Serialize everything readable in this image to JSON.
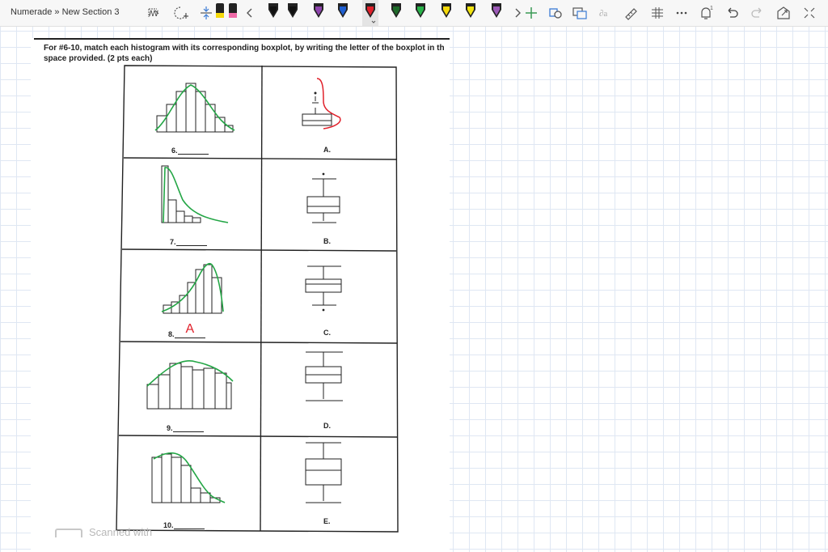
{
  "app": {
    "breadcrumb": "Numerade » New Section 3"
  },
  "toolbar": {
    "icons": [
      "lasso-select-icon",
      "add-space-icon",
      "insert-space-icon",
      "scroll-left-icon",
      "scroll-right-icon",
      "add-pen-icon",
      "ink-to-shape-icon",
      "ink-to-text-icon",
      "math-icon",
      "ruler-icon",
      "format-icon",
      "more-icon",
      "notification-icon",
      "undo-icon",
      "redo-icon",
      "fullscreen-icon",
      "collapse-icon"
    ],
    "pens": [
      {
        "name": "yellow-highlighter",
        "color": "#f5d90a"
      },
      {
        "name": "pink-highlighter",
        "color": "#f06aa8"
      },
      {
        "name": "black-pen",
        "color": "#111111"
      },
      {
        "name": "black-pen-2",
        "color": "#111111"
      },
      {
        "name": "purple-pen",
        "color": "#8e44ad"
      },
      {
        "name": "blue-pen",
        "color": "#1f5fd1"
      },
      {
        "name": "red-pen",
        "color": "#e0202a",
        "selected": true
      },
      {
        "name": "dark-green-pen",
        "color": "#1e6b2a"
      },
      {
        "name": "green-pen",
        "color": "#29b34a"
      },
      {
        "name": "yellow-pen",
        "color": "#f5d90a"
      },
      {
        "name": "yellow-pen-2",
        "color": "#f2e40f"
      },
      {
        "name": "purple-pen-2",
        "color": "#9b59b6"
      }
    ],
    "notification_count": "1"
  },
  "worksheet": {
    "instructions": [
      "For #6-10, match each histogram with its corresponding boxplot, by writing the letter of the boxplot in th",
      "space provided. (2 pts each)"
    ],
    "rows": [
      {
        "question": "6.",
        "answer": "",
        "boxplot_letter": "A."
      },
      {
        "question": "7.",
        "answer": "",
        "boxplot_letter": "B."
      },
      {
        "question": "8.",
        "answer": "A",
        "boxplot_letter": "C."
      },
      {
        "question": "9.",
        "answer": "",
        "boxplot_letter": "D."
      },
      {
        "question": "10.",
        "answer": "",
        "boxplot_letter": "E."
      }
    ],
    "ink_colors": {
      "green": "#24a646",
      "red": "#e0202a"
    },
    "footer_watermark": "Scanned with"
  }
}
